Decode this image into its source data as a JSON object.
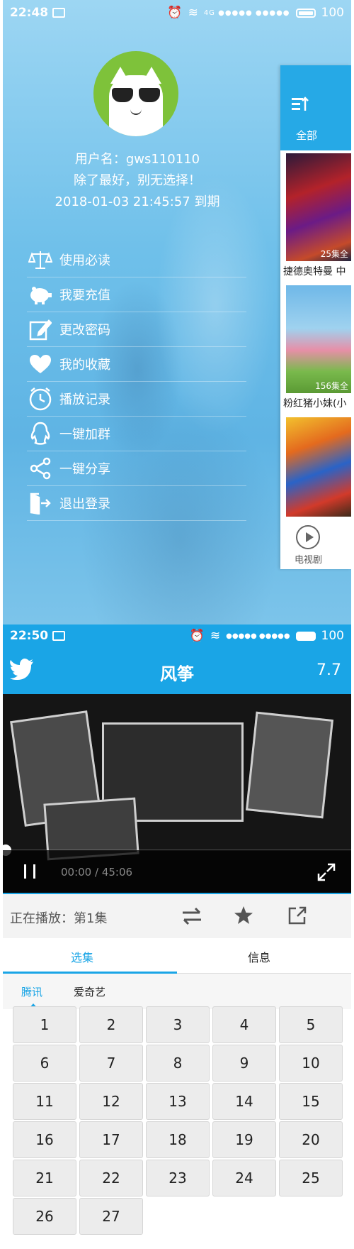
{
  "drawer": {
    "status_bar": {
      "time": "22:48",
      "battery": "100",
      "signal": "4G ●●●●● ●●●●●"
    },
    "profile": {
      "username_line": "用户名：gws110110",
      "motto": "除了最好，别无选择！",
      "expiry": "2018-01-03 21:45:57 到期"
    },
    "menu": [
      {
        "label": "使用必读",
        "icon": "scale-icon"
      },
      {
        "label": "我要充值",
        "icon": "piggy-bank-icon"
      },
      {
        "label": "更改密码",
        "icon": "edit-icon"
      },
      {
        "label": "我的收藏",
        "icon": "heart-icon"
      },
      {
        "label": "播放记录",
        "icon": "clock-icon"
      },
      {
        "label": "一键加群",
        "icon": "qq-icon"
      },
      {
        "label": "一键分享",
        "icon": "share-icon"
      },
      {
        "label": "退出登录",
        "icon": "logout-icon"
      }
    ],
    "peek": {
      "all_label": "全部",
      "items": [
        {
          "title": "捷德奥特曼 中",
          "episodes": "25集全"
        },
        {
          "title": "粉红猪小妹(小",
          "episodes": "156集全"
        },
        {
          "title": "",
          "episodes": ""
        }
      ],
      "tv_label": "电视剧"
    }
  },
  "player": {
    "status_bar": {
      "time": "22:50",
      "battery": "100"
    },
    "title": "风筝",
    "score": "7.7",
    "video": {
      "time": "00:00 / 45:06"
    },
    "now_playing": "正在播放：第1集",
    "tabs": [
      "选集",
      "信息"
    ],
    "sources": [
      "腾讯",
      "爱奇艺"
    ],
    "episodes": [
      "1",
      "2",
      "3",
      "4",
      "5",
      "6",
      "7",
      "8",
      "9",
      "10",
      "11",
      "12",
      "13",
      "14",
      "15",
      "16",
      "17",
      "18",
      "19",
      "20",
      "21",
      "22",
      "23",
      "24",
      "25",
      "26",
      "27"
    ],
    "colors": {
      "accent": "#1aa5e6"
    }
  }
}
